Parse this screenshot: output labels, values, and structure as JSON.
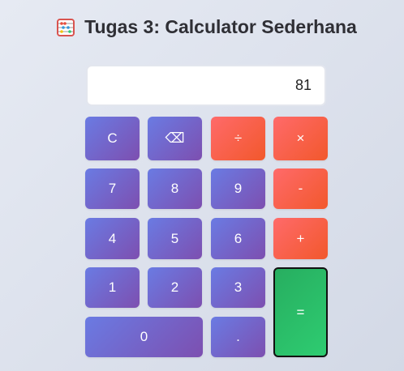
{
  "header": {
    "icon": "abacus-icon",
    "title": "Tugas 3: Calculator Sederhana"
  },
  "display": {
    "value": "81"
  },
  "buttons": {
    "clear": "C",
    "backspace": "⌫",
    "divide": "÷",
    "multiply": "×",
    "seven": "7",
    "eight": "8",
    "nine": "9",
    "minus": "-",
    "four": "4",
    "five": "5",
    "six": "6",
    "plus": "+",
    "one": "1",
    "two": "2",
    "three": "3",
    "equals": "=",
    "zero": "0",
    "decimal": "."
  },
  "colors": {
    "number_button": "#6a7be3",
    "operator_button": "#ff6a6a",
    "equals_button": "#2ecc71"
  }
}
